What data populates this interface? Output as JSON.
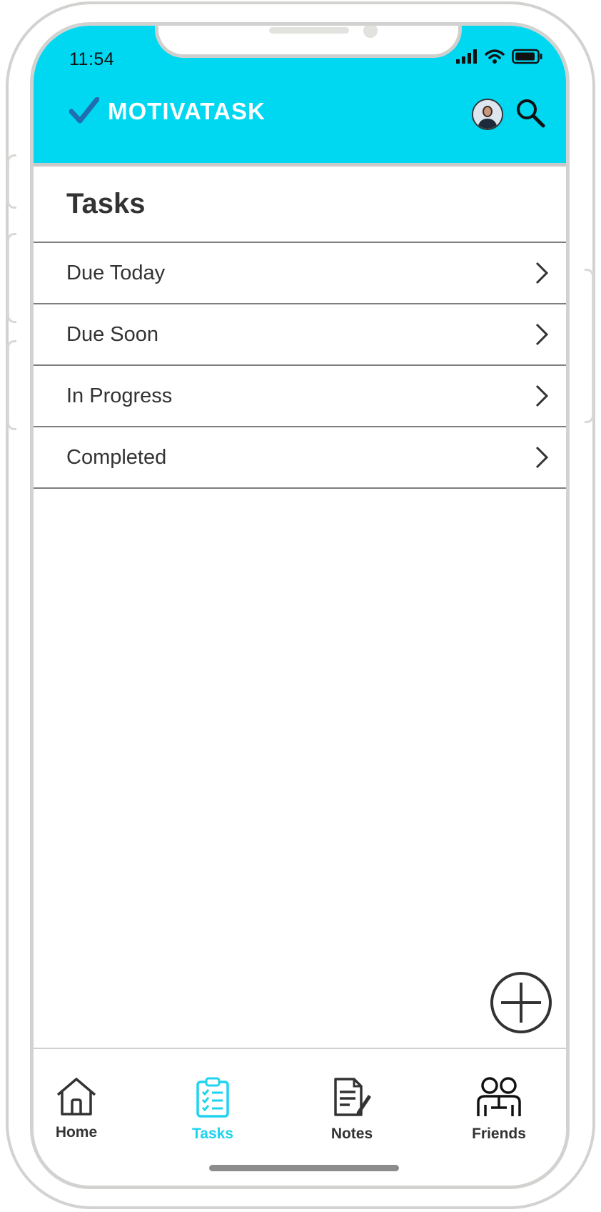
{
  "status_bar": {
    "time": "11:54"
  },
  "header": {
    "brand": "MOTIVATASK",
    "avatar_icon": "profile-avatar",
    "search_icon": "search-icon"
  },
  "page": {
    "title": "Tasks"
  },
  "task_groups": [
    {
      "label": "Due Today"
    },
    {
      "label": "Due Soon"
    },
    {
      "label": "In Progress"
    },
    {
      "label": "Completed"
    }
  ],
  "fab": {
    "icon": "plus-icon"
  },
  "tabbar": {
    "items": [
      {
        "label": "Home",
        "icon": "home-icon",
        "active": false
      },
      {
        "label": "Tasks",
        "icon": "clipboard-icon",
        "active": true
      },
      {
        "label": "Notes",
        "icon": "notes-icon",
        "active": false
      },
      {
        "label": "Friends",
        "icon": "friends-icon",
        "active": false
      }
    ]
  },
  "colors": {
    "accent": "#00d7f1",
    "active_tab": "#1ed3ef",
    "text": "#333333",
    "logo_check": "#1f6fb0"
  }
}
